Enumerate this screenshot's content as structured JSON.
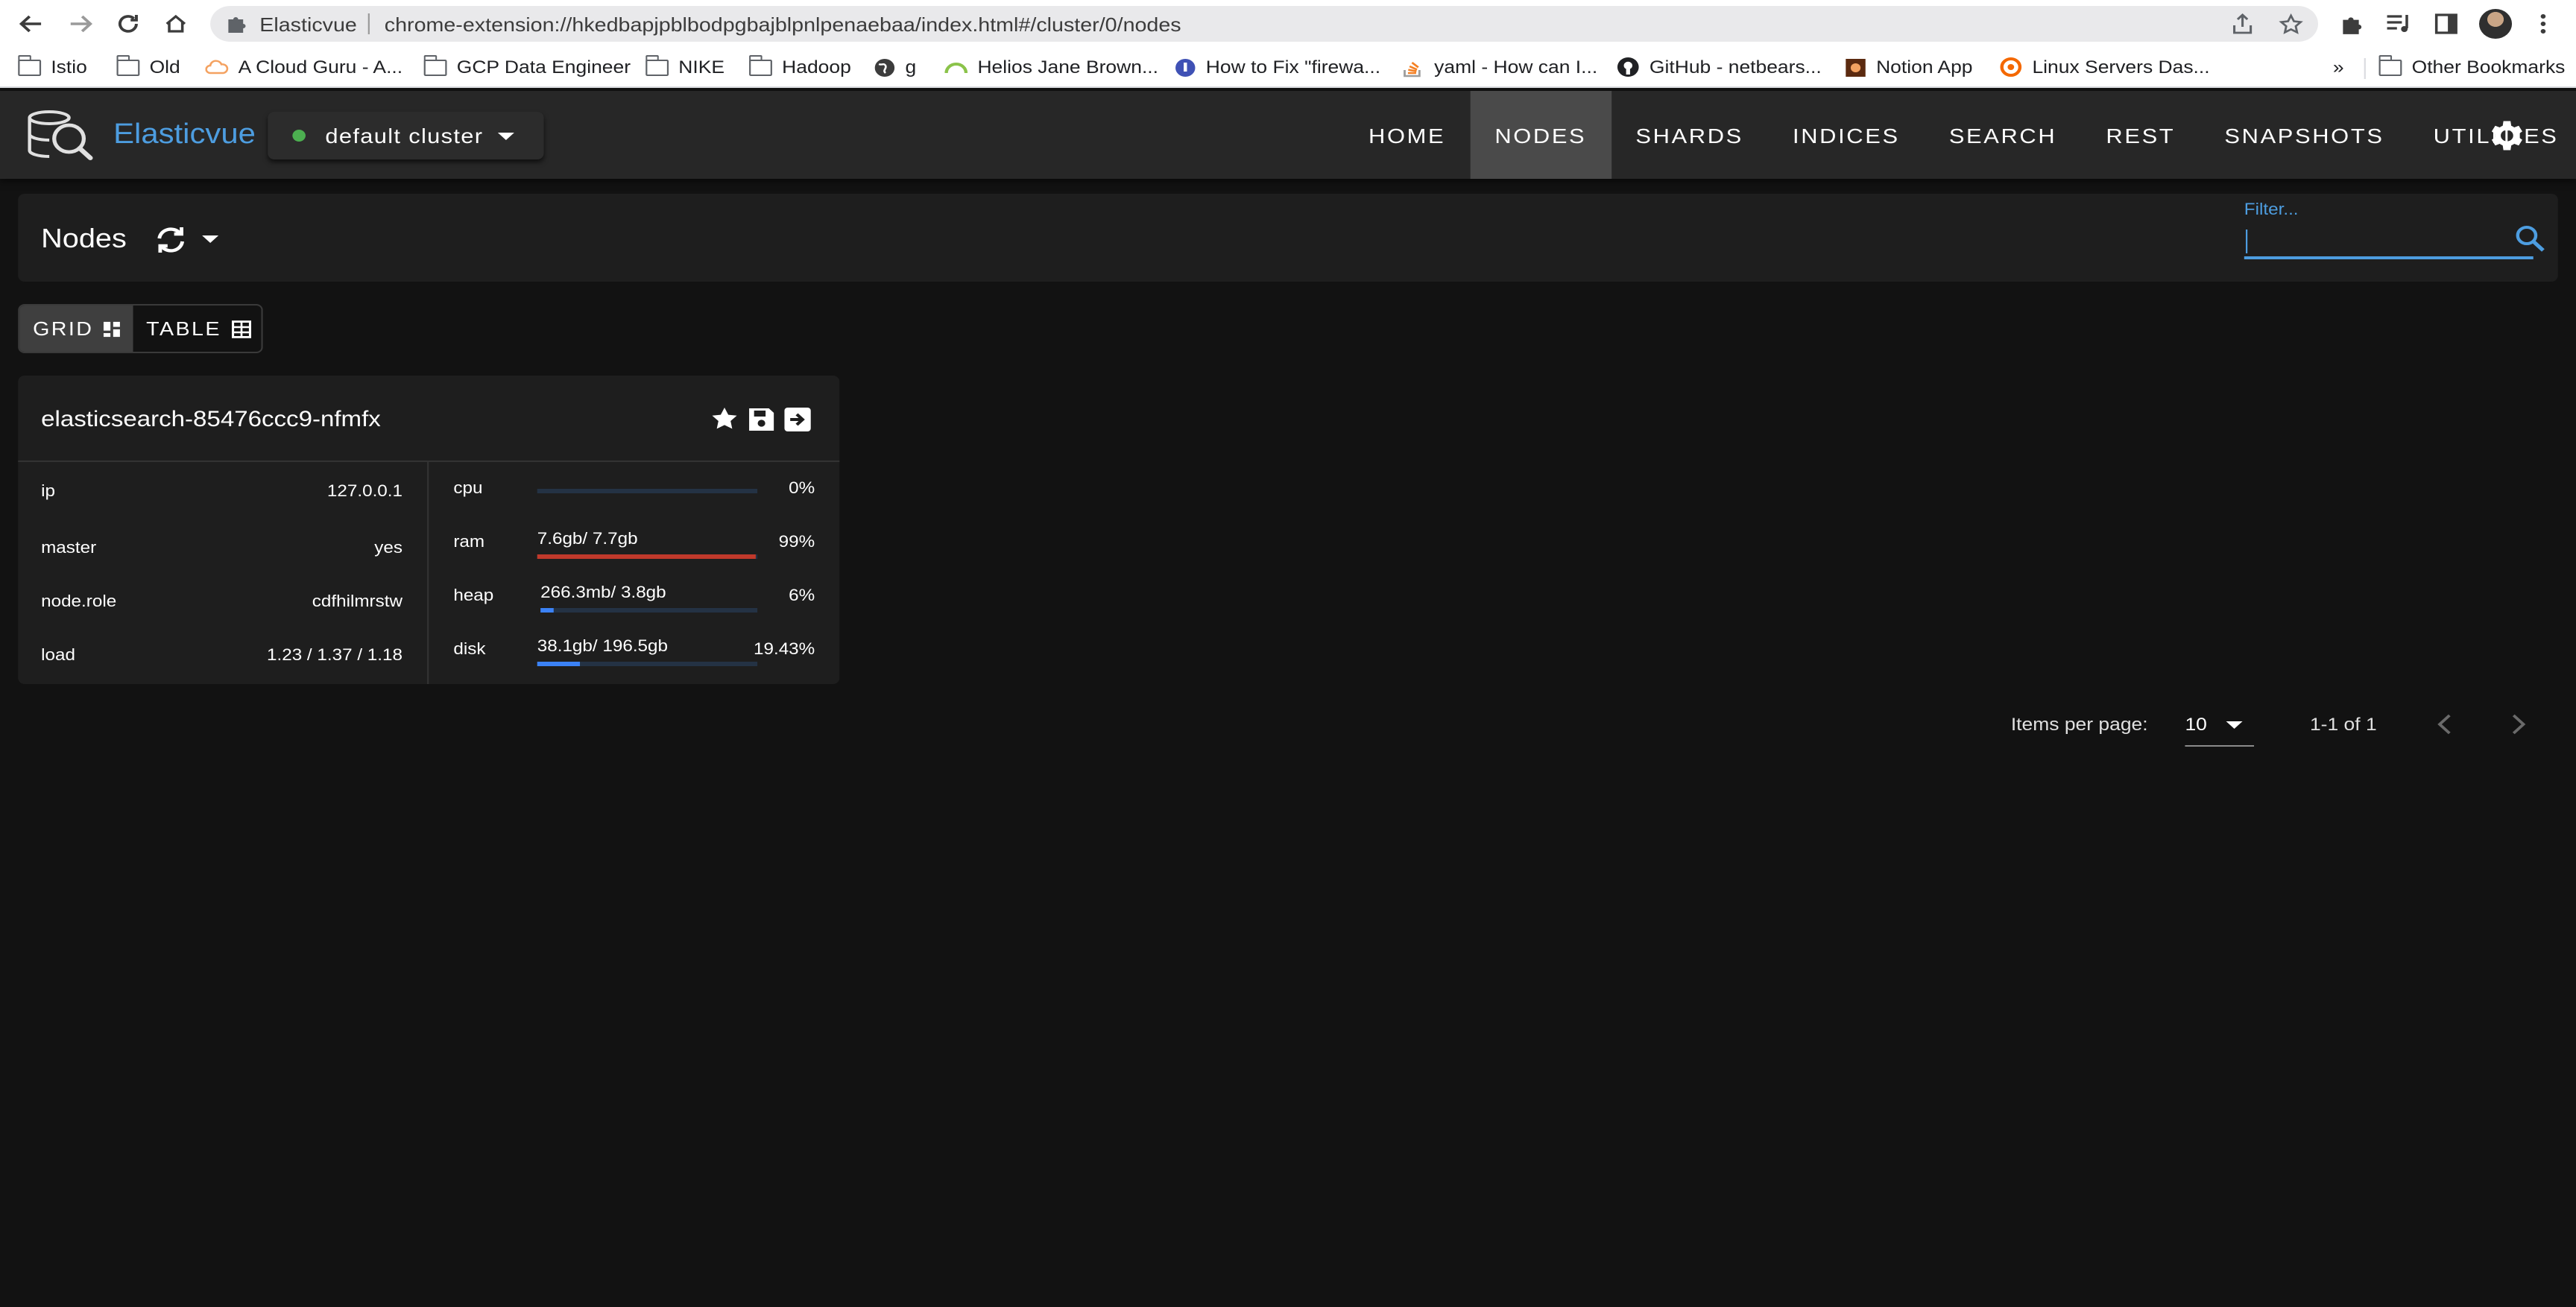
{
  "browser": {
    "site_name": "Elasticvue",
    "url": "chrome-extension://hkedbapjpblbodpgbajblpnlpenaebaa/index.html#/cluster/0/nodes",
    "bookmarks": [
      {
        "label": "Istio",
        "icon": "folder-icon"
      },
      {
        "label": "Old",
        "icon": "folder-icon"
      },
      {
        "label": "A Cloud Guru - A...",
        "icon": "cloud-icon"
      },
      {
        "label": "GCP Data Engineer",
        "icon": "folder-icon"
      },
      {
        "label": "NIKE",
        "icon": "folder-icon"
      },
      {
        "label": "Hadoop",
        "icon": "folder-icon"
      },
      {
        "label": "g",
        "icon": "globe-icon"
      },
      {
        "label": "Helios Jane Brown...",
        "icon": "helios-icon"
      },
      {
        "label": "How to Fix \"firewa...",
        "icon": "shield-icon"
      },
      {
        "label": "yaml - How can I...",
        "icon": "stackoverflow-icon"
      },
      {
        "label": "GitHub - netbears...",
        "icon": "github-icon"
      },
      {
        "label": "Notion App",
        "icon": "notion-icon"
      },
      {
        "label": "Linux Servers Das...",
        "icon": "grafana-icon"
      }
    ],
    "overflow_label": "»",
    "other_bookmarks": "Other Bookmarks"
  },
  "app": {
    "brand": "Elasticvue",
    "cluster_name": "default cluster",
    "cluster_status_color": "#4caf50",
    "accent_color": "#4d9de0",
    "nav": [
      "HOME",
      "NODES",
      "SHARDS",
      "INDICES",
      "SEARCH",
      "REST",
      "SNAPSHOTS",
      "UTILITIES"
    ],
    "active_nav": "NODES"
  },
  "page": {
    "title": "Nodes",
    "filter_label": "Filter...",
    "filter_value": "",
    "view_toggle": {
      "grid": "GRID",
      "table": "TABLE",
      "active": "GRID"
    }
  },
  "node": {
    "name": "elasticsearch-85476ccc9-nfmfx",
    "properties": [
      {
        "key": "ip",
        "value": "127.0.0.1"
      },
      {
        "key": "master",
        "value": "yes"
      },
      {
        "key": "node.role",
        "value": "cdfhilmrstw"
      },
      {
        "key": "load",
        "value": "1.23 / 1.37 / 1.18"
      }
    ],
    "metrics": [
      {
        "key": "cpu",
        "text": "",
        "percent": "0%",
        "fill": 0.0,
        "color": "#3b82f6"
      },
      {
        "key": "ram",
        "text": "7.6gb/ 7.7gb",
        "percent": "99%",
        "fill": 0.99,
        "color": "#c0392b"
      },
      {
        "key": "heap",
        "text": "266.3mb/ 3.8gb",
        "percent": "6%",
        "fill": 0.06,
        "color": "#3b82f6"
      },
      {
        "key": "disk",
        "text": "38.1gb/ 196.5gb",
        "percent": "19.43%",
        "fill": 0.1943,
        "color": "#3b82f6"
      }
    ]
  },
  "pagination": {
    "items_per_page_label": "Items per page:",
    "items_per_page": "10",
    "range": "1-1 of 1"
  }
}
